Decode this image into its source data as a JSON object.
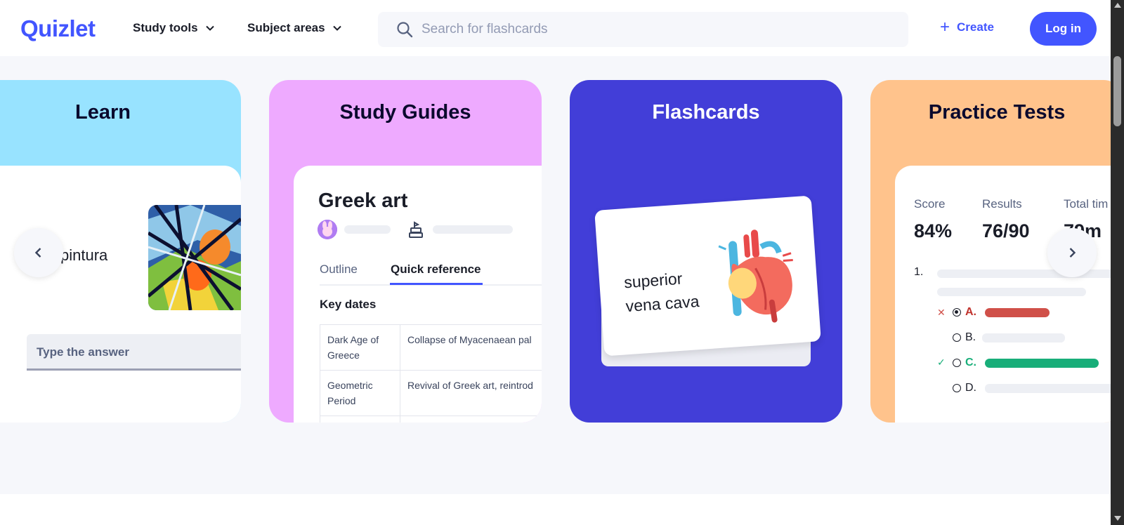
{
  "header": {
    "logo": "Quizlet",
    "nav": [
      {
        "label": "Study tools",
        "icon": "chevron-down-icon"
      },
      {
        "label": "Subject areas",
        "icon": "chevron-down-icon"
      }
    ],
    "search": {
      "placeholder": "Search for flashcards",
      "value": "",
      "icon": "search-icon"
    },
    "create_label": "Create",
    "login_label": "Log in",
    "brand_color": "#4255ff"
  },
  "cards": {
    "learn": {
      "title": "Learn",
      "word": "pintura",
      "answer_placeholder": "Type the answer",
      "color": "#98e3ff"
    },
    "study_guides": {
      "title": "Study Guides",
      "doc_title": "Greek art",
      "tabs": [
        {
          "label": "Outline",
          "active": false
        },
        {
          "label": "Quick reference",
          "active": true
        }
      ],
      "section": "Key dates",
      "rows": [
        {
          "term": "Dark Age of Greece",
          "desc": "Collapse of Myacenaean pal"
        },
        {
          "term": "Geometric Period",
          "desc": "Revival of Greek art, reintrod"
        }
      ],
      "color": "#eeaaff"
    },
    "flashcards": {
      "title": "Flashcards",
      "term_line1": "superior",
      "term_line2": "vena cava",
      "color": "#423ed8"
    },
    "practice_tests": {
      "title": "Practice Tests",
      "stats": [
        {
          "label": "Score",
          "value": "84%"
        },
        {
          "label": "Results",
          "value": "76/90"
        },
        {
          "label": "Total tim",
          "value": "79m"
        }
      ],
      "question_number": "1.",
      "options": [
        {
          "letter": "A.",
          "state": "wrong",
          "selected": true,
          "mark": "✕"
        },
        {
          "letter": "B.",
          "state": "neutral",
          "selected": false,
          "mark": ""
        },
        {
          "letter": "C.",
          "state": "correct",
          "selected": false,
          "mark": "✓"
        },
        {
          "letter": "D.",
          "state": "neutral",
          "selected": false,
          "mark": ""
        }
      ],
      "color": "#ffc38c",
      "wrong_color": "#d05049",
      "correct_color": "#18ae79"
    }
  },
  "carousel": {
    "prev_icon": "chevron-left-icon",
    "next_icon": "chevron-right-icon"
  }
}
